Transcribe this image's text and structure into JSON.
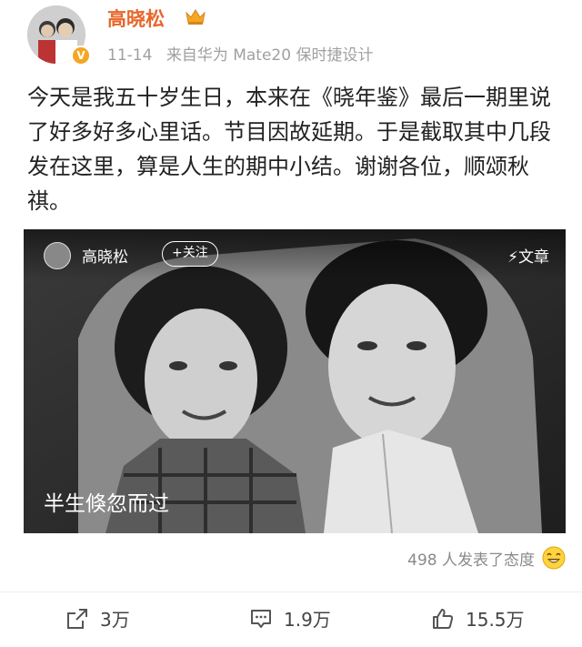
{
  "user": {
    "name": "高晓松",
    "verified_badge": "V",
    "date": "11-14",
    "source": "来自华为 Mate20 保时捷设计"
  },
  "post": {
    "text": "今天是我五十岁生日，本来在《晓年鉴》最后一期里说了好多好多心里话。节目因故延期。于是截取其中几段发在这里，算是人生的期中小结。谢谢各位，顺颂秋祺。"
  },
  "media": {
    "author": "高晓松",
    "follow_label": "+关注",
    "article_label": "文章",
    "caption": "半生倏忽而过"
  },
  "reactions": {
    "text": "498 人发表了态度"
  },
  "actions": {
    "repost_count": "3万",
    "comment_count": "1.9万",
    "like_count": "15.5万"
  },
  "colors": {
    "name": "#e8662a",
    "meta": "#a0a0a0",
    "badge": "#f5a623"
  }
}
